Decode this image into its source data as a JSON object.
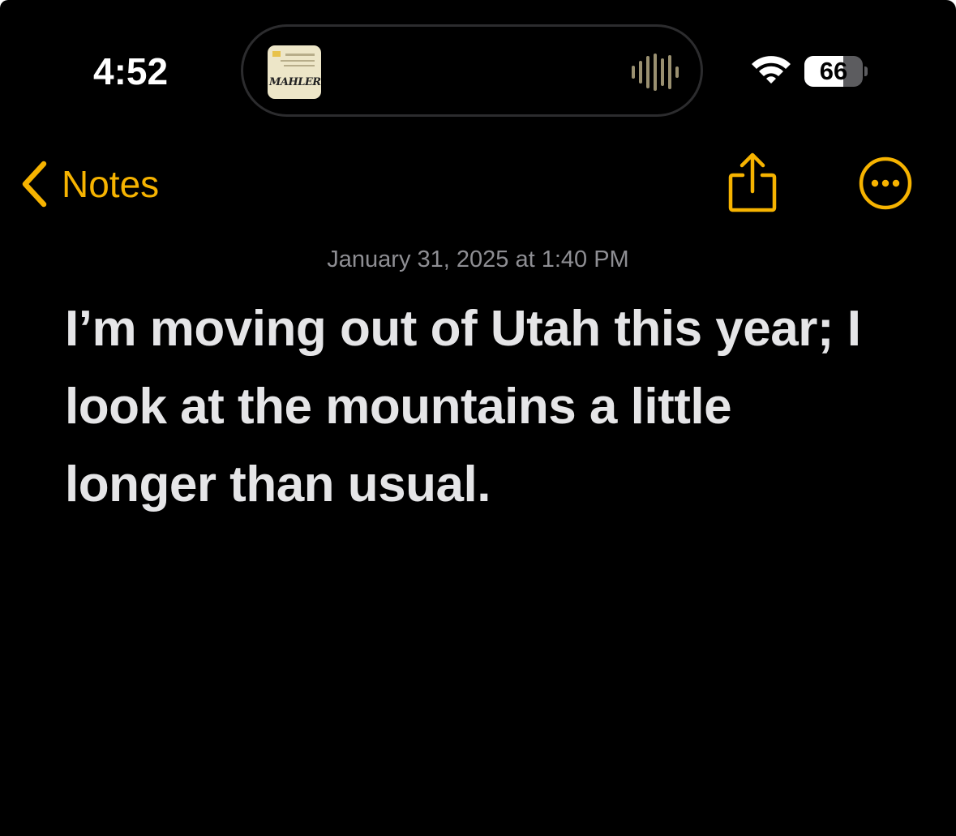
{
  "status_bar": {
    "time": "4:52",
    "battery_percent": "66",
    "battery_level": 0.66,
    "wifi_icon": "wifi-icon",
    "waveform_icon": "waveform-icon"
  },
  "now_playing": {
    "album_art_text": "MAHLER"
  },
  "nav": {
    "back_label": "Notes",
    "back_icon": "chevron-left-icon",
    "share_icon": "share-icon",
    "more_icon": "ellipsis-circle-icon"
  },
  "note": {
    "date": "January 31, 2025 at 1:40 PM",
    "body": "I’m moving out of Utah this year; I look at the mountains a little longer than usual."
  },
  "colors": {
    "accent": "#f6b300",
    "background": "#000000",
    "text": "#e5e5e7",
    "secondary_text": "#8e8e93"
  }
}
